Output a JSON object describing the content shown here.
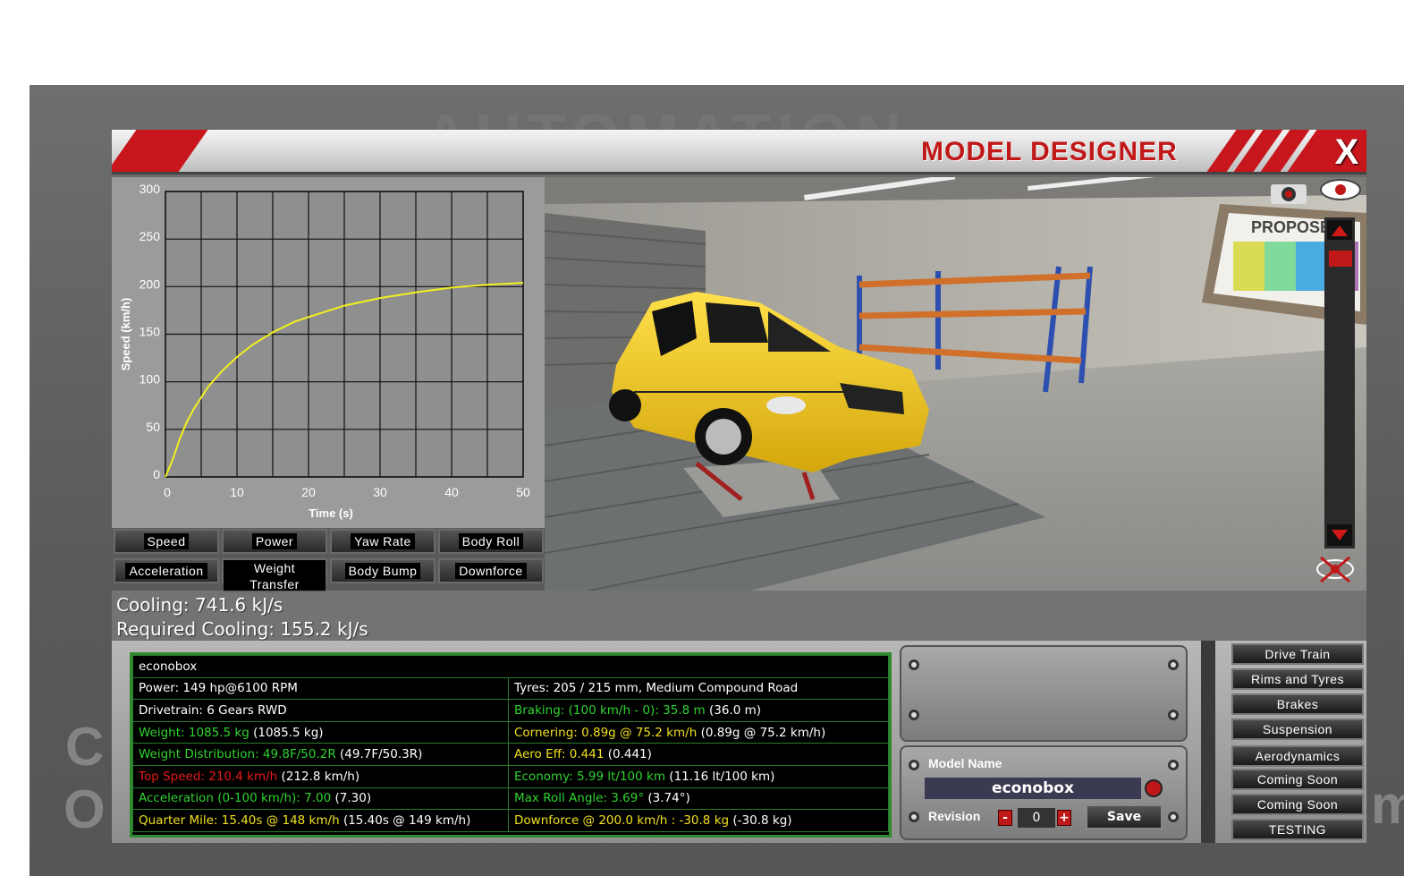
{
  "window": {
    "title": "MODEL DESIGNER",
    "close_label": "X"
  },
  "background": {
    "logo_text": "AUTOMATION",
    "left_letters": [
      "C",
      "O"
    ],
    "right_letter": "m"
  },
  "chart_data": {
    "type": "line",
    "title": "",
    "xlabel": "Time (s)",
    "ylabel": "Speed (km/h)",
    "xlim": [
      0,
      50
    ],
    "ylim": [
      0,
      300
    ],
    "x_ticks": [
      "0",
      "10",
      "20",
      "30",
      "40",
      "50"
    ],
    "y_ticks": [
      "0",
      "50",
      "100",
      "150",
      "200",
      "250",
      "300"
    ],
    "grid": true,
    "series": [
      {
        "x": [
          0,
          1,
          2,
          3,
          4,
          6,
          8,
          10,
          12,
          15,
          18,
          20,
          25,
          30,
          35,
          40,
          45,
          50
        ],
        "y": [
          0,
          18,
          40,
          58,
          72,
          95,
          112,
          126,
          138,
          152,
          163,
          168,
          180,
          188,
          194,
          199,
          202,
          204
        ],
        "color": "#f0f020"
      }
    ]
  },
  "chart_buttons": [
    {
      "label": "Speed"
    },
    {
      "label": "Power"
    },
    {
      "label": "Yaw Rate"
    },
    {
      "label": "Body Roll"
    },
    {
      "label": "Acceleration"
    },
    {
      "label": "Weight Transfer"
    },
    {
      "label": "Body Bump"
    },
    {
      "label": "Downforce"
    }
  ],
  "cooling": {
    "cooling": "Cooling: 741.6 kJ/s",
    "required": "Required Cooling: 155.2 kJ/s"
  },
  "stats": {
    "name": "econobox",
    "left": [
      {
        "label": "Power: 149 hp@6100 RPM",
        "extra": "",
        "color": "w"
      },
      {
        "label": "Drivetrain: 6 Gears RWD",
        "extra": "",
        "color": "w"
      },
      {
        "label": "Weight: 1085.5 kg",
        "extra": "(1085.5 kg)",
        "color": "g"
      },
      {
        "label": "Weight Distribution: 49.8F/50.2R",
        "extra": "(49.7F/50.3R)",
        "color": "g"
      },
      {
        "label": "Top Speed: 210.4 km/h",
        "extra": "(212.8 km/h)",
        "color": "r"
      },
      {
        "label": "Acceleration (0-100 km/h): 7.00",
        "extra": "(7.30)",
        "color": "g"
      },
      {
        "label": "Quarter Mile: 15.40s @ 148 km/h",
        "extra": "(15.40s @ 149 km/h)",
        "color": "y"
      }
    ],
    "right": [
      {
        "label": "Tyres: 205 / 215 mm, Medium Compound Road",
        "extra": "",
        "color": "w"
      },
      {
        "label": "Braking: (100 km/h - 0): 35.8 m",
        "extra": "(36.0 m)",
        "color": "g"
      },
      {
        "label": "Cornering: 0.89g @ 75.2 km/h",
        "extra": "(0.89g @ 75.2 km/h)",
        "color": "y"
      },
      {
        "label": "Aero Eff: 0.441",
        "extra": "(0.441)",
        "color": "y"
      },
      {
        "label": "Economy: 5.99 lt/100 km",
        "extra": "(11.16 lt/100 km)",
        "color": "g"
      },
      {
        "label": "Max Roll Angle: 3.69°",
        "extra": "(3.74°)",
        "color": "g"
      },
      {
        "label": "Downforce @ 200.0 km/h : -30.8 kg",
        "extra": "(-30.8 kg)",
        "color": "y"
      }
    ]
  },
  "model": {
    "name_label": "Model Name",
    "name_value": "econobox",
    "revision_label": "Revision",
    "revision_value": "0",
    "minus": "-",
    "plus": "+",
    "save": "Save"
  },
  "menu": [
    {
      "label": "Drive Train"
    },
    {
      "label": "Rims and Tyres"
    },
    {
      "label": "Brakes"
    },
    {
      "label": "Suspension"
    },
    {
      "label": "Aerodynamics"
    },
    {
      "label": "Coming Soon"
    },
    {
      "label": "Coming Soon"
    },
    {
      "label": "TESTING"
    }
  ],
  "scene": {
    "board_text": "PROPOSED",
    "car_color": "#f2c81a"
  },
  "colors": {
    "accent_red": "#c8161d",
    "stat_green": "#2fd32f",
    "stat_yellow": "#f0e020",
    "stat_red": "#e81818"
  }
}
